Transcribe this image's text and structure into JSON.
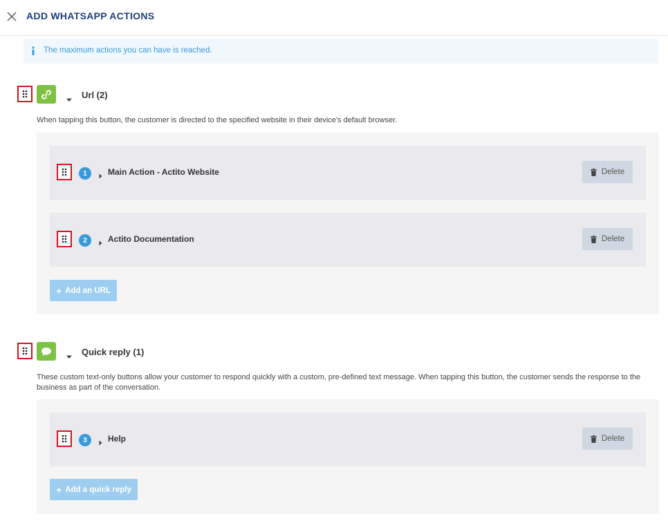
{
  "header": {
    "title": "ADD WHATSAPP ACTIONS"
  },
  "info": {
    "message": "The maximum actions you can have is reached."
  },
  "colors": {
    "accent": "#3a9ad9",
    "title": "#1c3f78",
    "type_icon": "#7dc243",
    "highlight": "#d8121e"
  },
  "sections": [
    {
      "icon": "link-icon",
      "title": "Url (2)",
      "description": "When tapping this button, the customer is directed to the specified website in their device's default browser.",
      "actions": [
        {
          "number": "1",
          "label": "Main Action - Actito Website",
          "delete_label": "Delete"
        },
        {
          "number": "2",
          "label": "Actito Documentation",
          "delete_label": "Delete"
        }
      ],
      "add_label": "Add an URL"
    },
    {
      "icon": "chat-bubble-icon",
      "title": "Quick reply (1)",
      "description": "These custom text-only buttons allow your customer to respond quickly with a custom, pre-defined text message. When tapping this button, the customer sends the response to the business as part of the conversation.",
      "actions": [
        {
          "number": "3",
          "label": "Help",
          "delete_label": "Delete"
        }
      ],
      "add_label": "Add a quick reply"
    }
  ]
}
